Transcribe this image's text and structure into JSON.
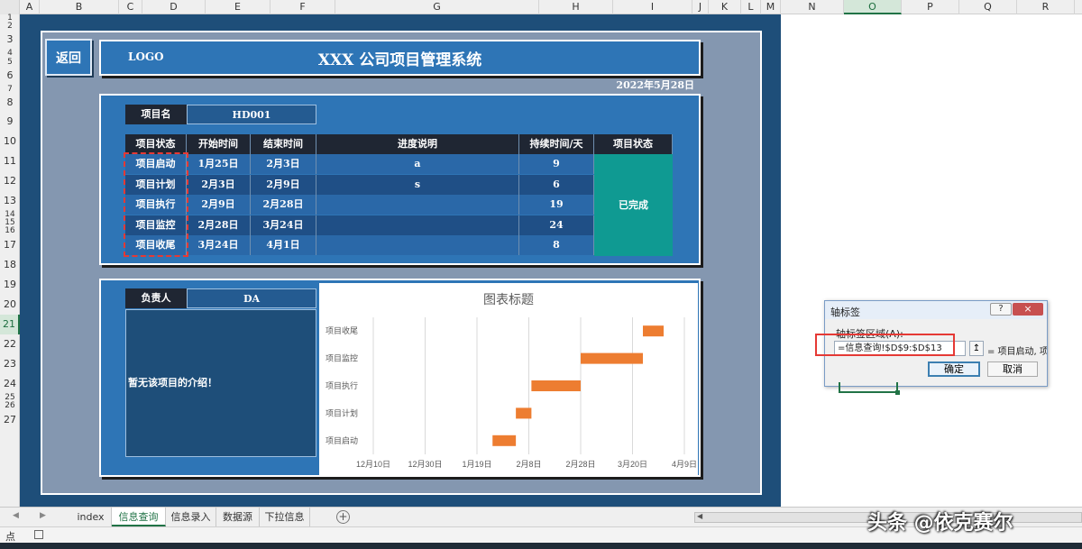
{
  "spreadsheet": {
    "column_headers": [
      "A",
      "B",
      "C",
      "D",
      "E",
      "F",
      "G",
      "H",
      "I",
      "J",
      "K",
      "L",
      "M",
      "N",
      "O",
      "P",
      "Q",
      "R"
    ],
    "selected_column": "O",
    "row_headers": [
      "1",
      "2",
      "3",
      "4",
      "5",
      "6",
      "7",
      "8",
      "9",
      "10",
      "11",
      "12",
      "13",
      "14",
      "15",
      "16",
      "17",
      "18",
      "19",
      "20",
      "21",
      "22",
      "23",
      "24",
      "25",
      "26",
      "27"
    ],
    "selected_row": "21"
  },
  "header": {
    "back_label": "返回",
    "logo": "LOGO",
    "title": "XXX 公司项目管理系统",
    "date": "2022年5月28日"
  },
  "project": {
    "name_label": "项目名",
    "name_value": "HD001",
    "columns": [
      "项目状态",
      "开始时间",
      "结束时间",
      "进度说明",
      "持续时间/天",
      "项目状态"
    ],
    "rows": [
      {
        "stage": "项目启动",
        "start": "1月25日",
        "end": "2月3日",
        "note": "a",
        "days": "9"
      },
      {
        "stage": "项目计划",
        "start": "2月3日",
        "end": "2月9日",
        "note": "s",
        "days": "6"
      },
      {
        "stage": "项目执行",
        "start": "2月9日",
        "end": "2月28日",
        "note": "",
        "days": "19"
      },
      {
        "stage": "项目监控",
        "start": "2月28日",
        "end": "3月24日",
        "note": "",
        "days": "24"
      },
      {
        "stage": "项目收尾",
        "start": "3月24日",
        "end": "4月1日",
        "note": "",
        "days": "8"
      }
    ],
    "overall_status": "已完成"
  },
  "owner": {
    "label": "负责人",
    "value": "DA",
    "intro": "暂无该项目的介绍！"
  },
  "chart_data": {
    "type": "bar",
    "orientation": "horizontal-gantt",
    "title": "图表标题",
    "categories": [
      "项目收尾",
      "项目监控",
      "项目执行",
      "项目计划",
      "项目启动"
    ],
    "series": [
      {
        "values_start": [
          "2022-03-24",
          "2022-02-28",
          "2022-02-09",
          "2022-02-03",
          "2022-01-25"
        ],
        "values_end": [
          "2022-04-01",
          "2022-03-24",
          "2022-02-28",
          "2022-02-09",
          "2022-02-03"
        ]
      }
    ],
    "x_ticks": [
      "12月10日",
      "12月30日",
      "1月19日",
      "2月8日",
      "2月28日",
      "3月20日",
      "4月9日"
    ],
    "xlim": [
      "2021-12-10",
      "2022-04-09"
    ],
    "bar_color": "#ed7d31",
    "grid": true
  },
  "sheet_tabs": [
    "index",
    "信息查询",
    "信息录入",
    "数据源",
    "下拉信息"
  ],
  "active_tab": "信息查询",
  "status_bar": {
    "mode": "点"
  },
  "dialog": {
    "title": "轴标签",
    "help": "?",
    "close": "×",
    "field_label": "轴标签区域(A):",
    "field_value": "=信息查询!$D$9:$D$13",
    "collapse_icon": "↥",
    "preview": "= 项目启动, 项目",
    "ok_label": "确定",
    "cancel_label": "取消"
  },
  "watermark": "头条 @依克赛尔",
  "colors": {
    "navy": "#1e4e79",
    "panel_blue": "#2e75b6",
    "teal_status": "#0f9a92",
    "highlight_red": "#e53935",
    "excel_green": "#217346"
  }
}
